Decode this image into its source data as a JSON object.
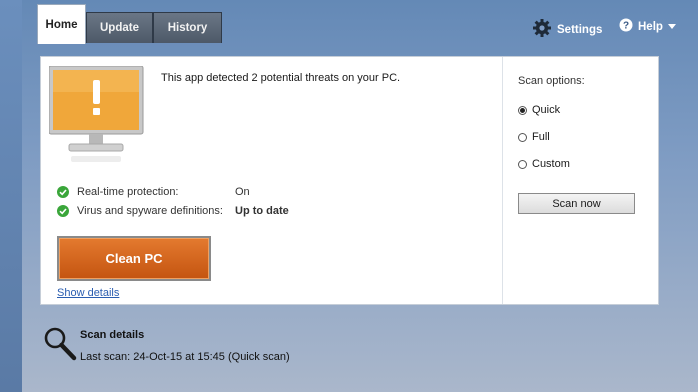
{
  "tabs": [
    {
      "label": "Home",
      "active": true
    },
    {
      "label": "Update",
      "active": false
    },
    {
      "label": "History",
      "active": false
    }
  ],
  "header": {
    "settings_label": "Settings",
    "help_label": "Help"
  },
  "main": {
    "alert_text": "This app detected 2 potential threats on your PC.",
    "status": [
      {
        "label": "Real-time protection:",
        "value": "On"
      },
      {
        "label": "Virus and spyware definitions:",
        "value": "Up to date"
      }
    ],
    "clean_button_label": "Clean PC",
    "show_details_label": "Show details"
  },
  "scan_options": {
    "title": "Scan options:",
    "options": [
      {
        "label": "Quick",
        "selected": true
      },
      {
        "label": "Full",
        "selected": false
      },
      {
        "label": "Custom",
        "selected": false
      }
    ],
    "scan_now_label": "Scan now"
  },
  "scan_details": {
    "title": "Scan details",
    "last_scan": "Last scan:  24-Oct-15 at 15:45 (Quick scan)"
  },
  "colors": {
    "accent_orange": "#c45410",
    "status_green": "#3aa63a",
    "window_blue": "#5b7fa8"
  },
  "icons": [
    "gear-icon",
    "help-icon",
    "chevron-down-icon",
    "warning-monitor-icon",
    "check-icon",
    "search-icon"
  ]
}
